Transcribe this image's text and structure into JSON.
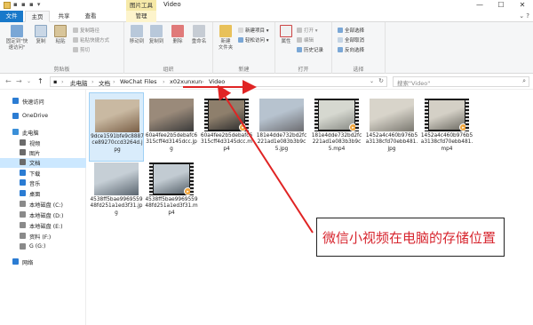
{
  "title_bar": {
    "quick_access": "▪ ▪ ▪ ▾",
    "context_tab_header": "图片工具",
    "window_title": "Video",
    "controls": [
      "—",
      "☐",
      "✕"
    ]
  },
  "ribbon_tabs": {
    "file": "文件",
    "home": "主页",
    "share": "共享",
    "view": "查看",
    "manage": "管理",
    "help_icon": "⌄ ?"
  },
  "ribbon": {
    "clipboard": {
      "label": "剪贴板",
      "pin": "固定到\"快\n速访问\"",
      "copy": "复制",
      "paste": "粘贴",
      "copy_path": "复制路径",
      "paste_shortcut": "粘贴快捷方式",
      "cut": "剪切"
    },
    "organize": {
      "label": "组织",
      "move_to": "移动到",
      "copy_to": "复制到",
      "delete": "删除",
      "rename": "重命名"
    },
    "new": {
      "label": "新建",
      "new_folder": "新建\n文件夹",
      "new_item": "新建项目 ▾",
      "easy_access": "轻松访问 ▾"
    },
    "open": {
      "label": "打开",
      "properties": "属性",
      "open": "打开 ▾",
      "edit": "编辑",
      "history": "历史记录"
    },
    "select": {
      "label": "选择",
      "select_all": "全部选择",
      "select_none": "全部取消",
      "invert": "反向选择"
    }
  },
  "nav": {
    "back": "←",
    "forward": "→",
    "recent": "⌄",
    "up": "↑"
  },
  "breadcrumb": [
    "此电脑",
    "文档",
    "WeChat Files",
    "x02xunxun",
    "Video"
  ],
  "breadcrumb_sep": "›",
  "search": {
    "placeholder": "搜索\"Video\""
  },
  "sidebar": [
    {
      "label": "快速访问",
      "icon": "star-icon",
      "color": "#2b7cd3"
    },
    {
      "label": "OneDrive",
      "icon": "cloud-icon",
      "color": "#2b7cd3"
    },
    {
      "label": "此电脑",
      "icon": "computer-icon",
      "color": "#3a8fd8"
    },
    {
      "label": "视频",
      "icon": "video-folder-icon",
      "color": "#6b6b6b"
    },
    {
      "label": "图片",
      "icon": "picture-folder-icon",
      "color": "#6b6b6b"
    },
    {
      "label": "文档",
      "icon": "document-folder-icon",
      "color": "#6b6b6b"
    },
    {
      "label": "下载",
      "icon": "download-icon",
      "color": "#2b7cd3"
    },
    {
      "label": "音乐",
      "icon": "music-icon",
      "color": "#2b7cd3"
    },
    {
      "label": "桌面",
      "icon": "desktop-icon",
      "color": "#2b7cd3"
    },
    {
      "label": "本地磁盘 (C:)",
      "icon": "drive-icon",
      "color": "#8a8a8a"
    },
    {
      "label": "本地磁盘 (D:)",
      "icon": "drive-icon",
      "color": "#8a8a8a"
    },
    {
      "label": "本地磁盘 (E:)",
      "icon": "drive-icon",
      "color": "#8a8a8a"
    },
    {
      "label": "资料 (F:)",
      "icon": "drive-icon",
      "color": "#8a8a8a"
    },
    {
      "label": "G (G:)",
      "icon": "drive-icon",
      "color": "#8a8a8a"
    },
    {
      "label": "网络",
      "icon": "network-icon",
      "color": "#2b7cd3"
    }
  ],
  "files": [
    {
      "name": "9dce1591bfe9c8887ce89270ccd3264d.jpg",
      "kind": "photo",
      "colors": [
        "#c9b9a2",
        "#7a5f46"
      ]
    },
    {
      "name": "60a4fee2b5debafc6315cff4d3145dcc.jpg",
      "kind": "photo",
      "colors": [
        "#9a8a7a",
        "#3a3a3a"
      ]
    },
    {
      "name": "60a4fee2b5debafc6315cff4d3145dcc.mp4",
      "kind": "video",
      "colors": [
        "#8e7f6c",
        "#2f2f2f"
      ]
    },
    {
      "name": "181e4dde732bd2fc221ad1e083b3b9c5.jpg",
      "kind": "photo",
      "colors": [
        "#b7c3cf",
        "#6c6c70"
      ]
    },
    {
      "name": "181e4dde732bd2fc221ad1e083b3b9c5.mp4",
      "kind": "video",
      "colors": [
        "#d6d8d0",
        "#8a8c86"
      ]
    },
    {
      "name": "1452a4c460b976b5a3138cfd70ebb481.jpg",
      "kind": "photo",
      "colors": [
        "#d8d4ca",
        "#7a7870"
      ]
    },
    {
      "name": "1452a4c460b976b5a3138cfd70ebb481.mp4",
      "kind": "video",
      "colors": [
        "#d4d0c6",
        "#6e6c64"
      ]
    },
    {
      "name": "4538ff5bae996955948fd251a1ed3f31.jpg",
      "kind": "photo",
      "colors": [
        "#c6cfd6",
        "#5b6670"
      ]
    },
    {
      "name": "4538ff5bae996955948fd251a1ed3f31.mp4",
      "kind": "video",
      "colors": [
        "#c2cbd2",
        "#56616a"
      ]
    }
  ],
  "play_badge": "▸",
  "annotation": {
    "text": "微信小视频在电脑的存储位置"
  }
}
